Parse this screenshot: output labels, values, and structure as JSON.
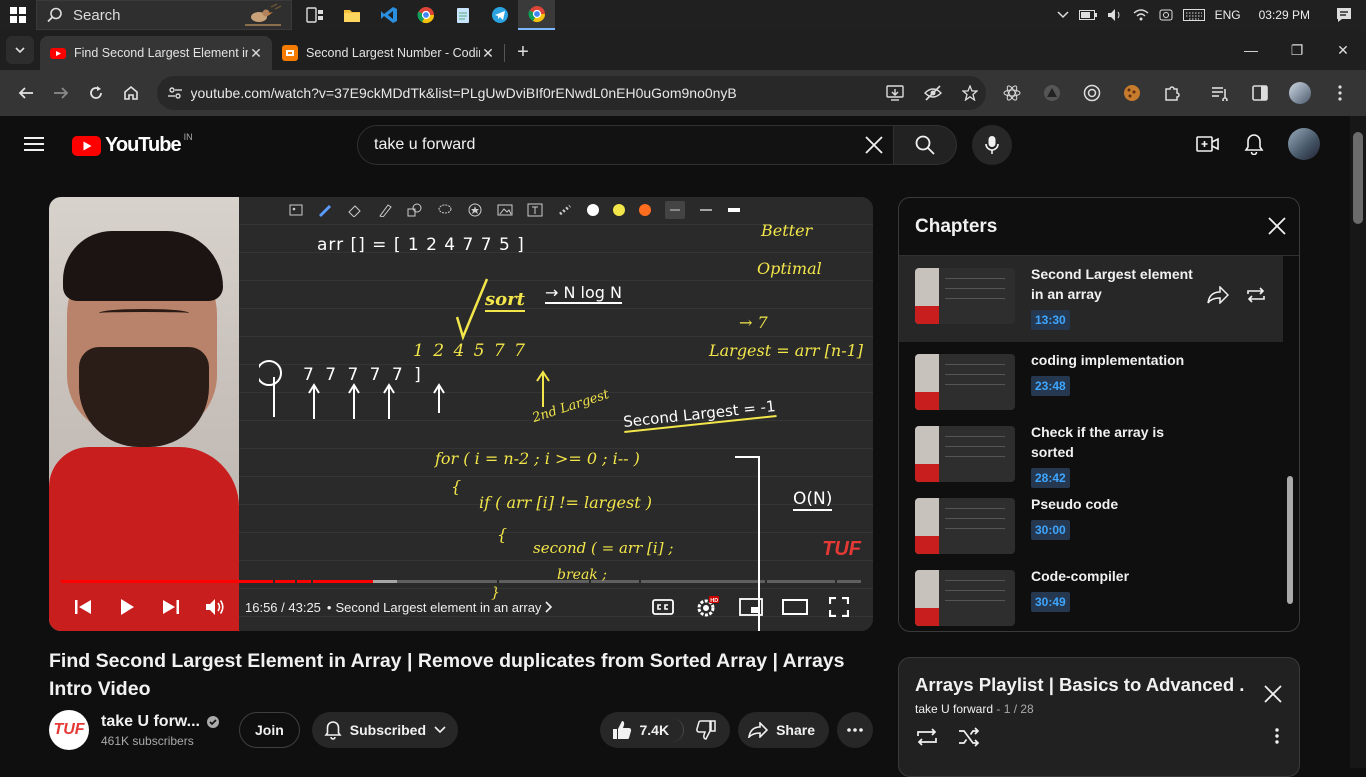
{
  "taskbar": {
    "search_label": "Search",
    "tray": {
      "lang": "ENG",
      "time": "03:29 PM"
    }
  },
  "tabs": [
    {
      "title": "Find Second Largest Element in",
      "active": true
    },
    {
      "title": "Second Largest Number - Codin",
      "active": false
    }
  ],
  "address": {
    "url": "youtube.com/watch?v=37E9ckMDdTk&list=PLgUwDviBIf0rENwdL0nEH0uGom9no0nyB"
  },
  "youtube": {
    "logo_text": "YouTube",
    "country": "IN",
    "search_query": "take u forward"
  },
  "player": {
    "time": "16:56 / 43:25",
    "chapter": "Second Largest element in an array",
    "progress_fraction": 0.39,
    "buffered_fraction": 0.42,
    "watermark": "TUF",
    "board": {
      "arr": "arr [] = [ 1   2   4   7   7   5 ]",
      "better": "Better",
      "optimal": "Optimal",
      "sort": "sort",
      "nlogn": "→ N log N",
      "nums": "1   2   4   5   7   7",
      "largest": "Largest = arr [n-1]",
      "seven": "→ 7",
      "second_largest": "Second Largest = -1",
      "second_label": "2nd Largest",
      "loop": "for ( i = n-2 ; i >= 0 ; i-- )",
      "brace_open": "{",
      "if_line": "if ( arr [i] != largest )",
      "inner_brace": "{",
      "assign": "second ( = arr [i] ;",
      "brk": "break ;",
      "brace_close": "}",
      "on": "O(N)",
      "white_row": "7   7   7   7  7 ]",
      "white_circle": "7"
    }
  },
  "video": {
    "title": "Find Second Largest Element in Array | Remove duplicates from Sorted Array | Arrays Intro Video",
    "channel": "take U forw...",
    "channel_logo": "TUF",
    "subscribers": "461K subscribers",
    "join": "Join",
    "subscribed": "Subscribed",
    "likes": "7.4K",
    "share": "Share"
  },
  "chapters": {
    "heading": "Chapters",
    "items": [
      {
        "title": "Second Largest element in an array",
        "time": "13:30",
        "active": true
      },
      {
        "title": "coding implementation",
        "time": "23:48",
        "active": false
      },
      {
        "title": "Check if the array is sorted",
        "time": "28:42",
        "active": false
      },
      {
        "title": "Pseudo code",
        "time": "30:00",
        "active": false
      },
      {
        "title": "Code-compiler",
        "time": "30:49",
        "active": false
      }
    ]
  },
  "playlist": {
    "title": "Arrays Playlist | Basics to Advanced ...",
    "owner": "take U forward",
    "position": " - 1 / 28"
  },
  "colors": {
    "accent_red": "#ff0000",
    "chapter_time": "#3ea6ff",
    "ink_yellow": "#f3e64a"
  }
}
